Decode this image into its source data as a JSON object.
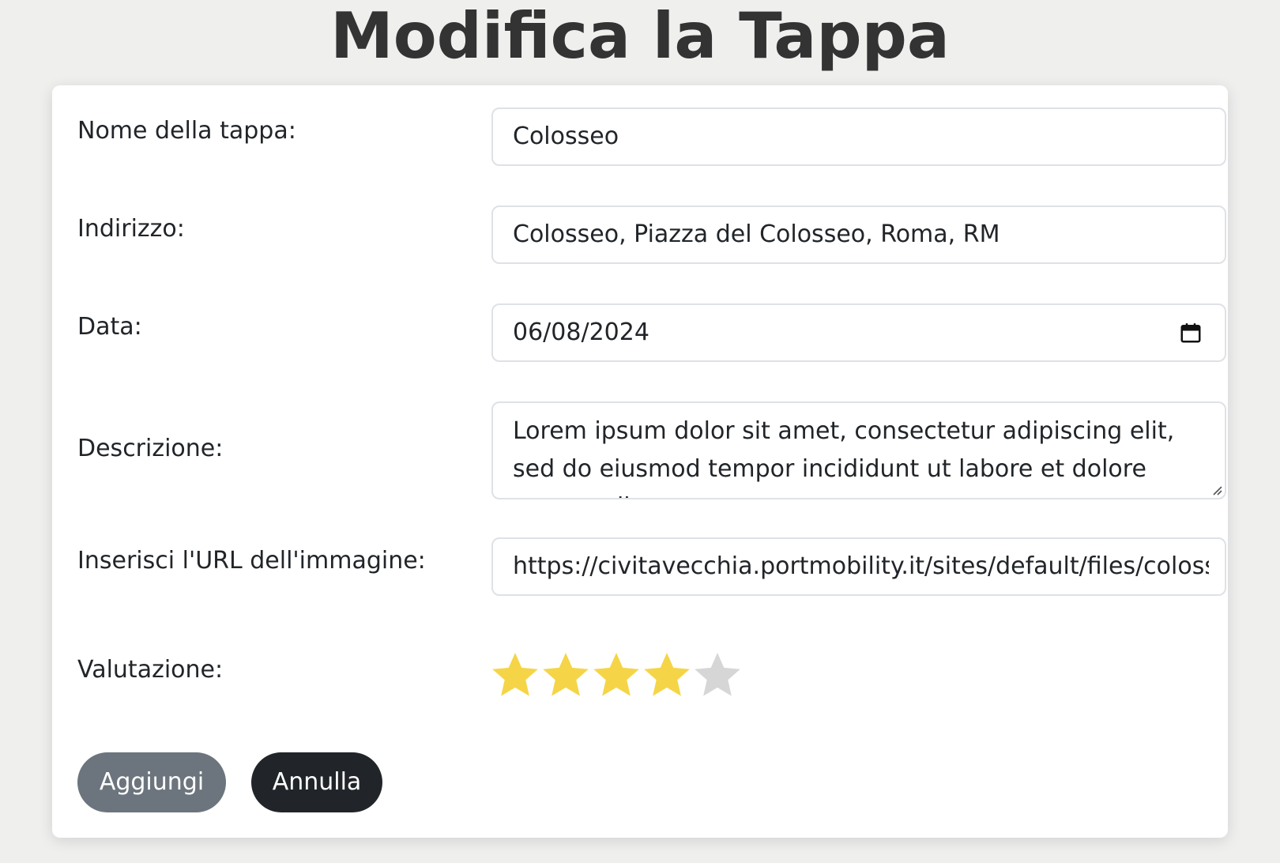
{
  "page": {
    "title": "Modifica la Tappa"
  },
  "form": {
    "name": {
      "label": "Nome della tappa:",
      "value": "Colosseo"
    },
    "address": {
      "label": "Indirizzo:",
      "value": "Colosseo, Piazza del Colosseo, Roma, RM"
    },
    "date": {
      "label": "Data:",
      "value": "06/08/2024",
      "icon": "calendar-icon"
    },
    "description": {
      "label": "Descrizione:",
      "value": "Lorem ipsum dolor sit amet, consectetur adipiscing elit, sed do eiusmod tempor incididunt ut labore et dolore magna aliqua."
    },
    "image_url": {
      "label": "Inserisci l'URL dell'immagine:",
      "value": "https://civitavecchia.portmobility.it/sites/default/files/colosseo.jpg"
    },
    "rating": {
      "label": "Valutazione:",
      "value": 4,
      "max": 5,
      "icon": "star-icon",
      "filled_color": "#f5d547",
      "empty_color": "#d6d6d6"
    }
  },
  "actions": {
    "add_label": "Aggiungi",
    "cancel_label": "Annulla"
  },
  "colors": {
    "background": "#efefee",
    "card": "#ffffff",
    "title": "#333333",
    "add_button": "#6c757d",
    "cancel_button": "#212529",
    "field_border": "#dee2e6"
  }
}
